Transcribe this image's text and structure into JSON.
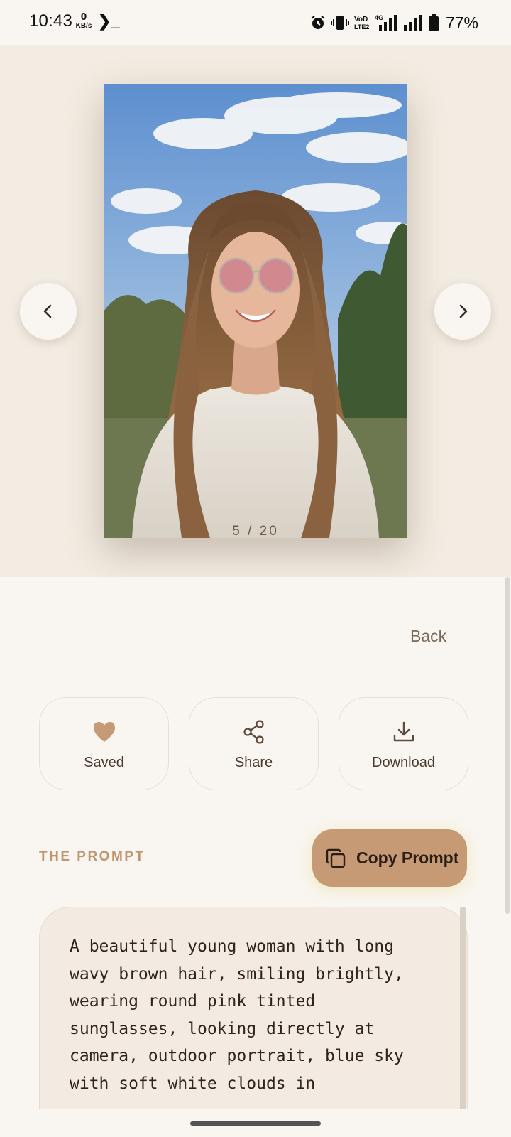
{
  "status_bar": {
    "time": "10:43",
    "net_speed_value": "0",
    "net_speed_unit": "KB/s",
    "terminal_glyph": "❯_",
    "battery_percent": "77%"
  },
  "viewer": {
    "counter": "5 / 20",
    "prev_icon": "chevron-left-icon",
    "next_icon": "chevron-right-icon"
  },
  "sheet": {
    "back_label": "Back",
    "actions": [
      {
        "label": "Saved",
        "icon": "heart-icon"
      },
      {
        "label": "Share",
        "icon": "share-icon"
      },
      {
        "label": "Download",
        "icon": "download-icon"
      }
    ],
    "section_label": "THE PROMPT",
    "copy_label": "Copy Prompt",
    "prompt_text": "A beautiful young woman with long\nwavy brown hair, smiling brightly,\nwearing round pink tinted\nsunglasses, looking directly at\ncamera, outdoor portrait, blue sky\nwith soft white clouds in"
  },
  "colors": {
    "accent": "#c69a74",
    "section_label": "#c2946b",
    "background": "#f9f6f1",
    "viewer_background": "#f3ece2"
  }
}
